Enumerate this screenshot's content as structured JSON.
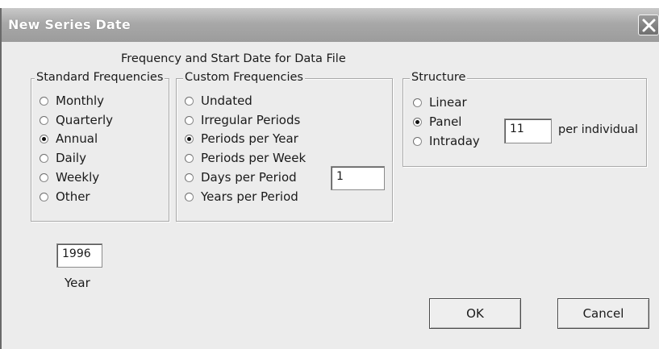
{
  "window": {
    "title": "New Series Date"
  },
  "heading": "Frequency and Start Date for Data File",
  "standard": {
    "legend": "Standard Frequencies",
    "options": [
      "Monthly",
      "Quarterly",
      "Annual",
      "Daily",
      "Weekly",
      "Other"
    ],
    "selected": "Annual"
  },
  "custom": {
    "legend": "Custom Frequencies",
    "options": [
      "Undated",
      "Irregular Periods",
      "Periods per Year",
      "Periods per Week",
      "Days per Period",
      "Years per Period"
    ],
    "selected": "Periods per Year",
    "value": "1"
  },
  "structure": {
    "legend": "Structure",
    "options": [
      "Linear",
      "Panel",
      "Intraday"
    ],
    "selected": "Panel",
    "value": "11",
    "suffix": "per individual"
  },
  "year": {
    "value": "1996",
    "label": "Year"
  },
  "buttons": {
    "ok": "OK",
    "cancel": "Cancel"
  },
  "icons": {
    "close": "close-icon"
  }
}
